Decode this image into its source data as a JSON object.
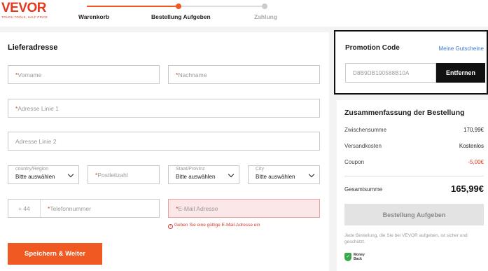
{
  "brand": {
    "name": "VEVOR",
    "tagline": "TOUGH TOOLS, HALF PRICE",
    "accent": "#e4381f"
  },
  "steps": [
    {
      "label": "Warenkorb",
      "state": "done"
    },
    {
      "label": "Bestellung Aufgeben",
      "state": "current"
    },
    {
      "label": "Zahlung",
      "state": "pending"
    }
  ],
  "address": {
    "title": "Lieferadresse",
    "first_name_ph": "Vorname",
    "last_name_ph": "Nachname",
    "address1_ph": "Adresse Linie 1",
    "address2_ph": "Adresse Linie 2",
    "country_label": "country/Region",
    "country_value": "Bitte auswählen",
    "zip_ph": "Postleitzahl",
    "state_label": "Staat/Provinz",
    "state_value": "Bitte auswählen",
    "city_label": "City",
    "city_value": "Bitte auswählen",
    "phone_prefix": "+ 44",
    "phone_ph": "Telefonnummer",
    "email_ph": "E-Mail Adresse",
    "email_error": "Geben Sie eine gültige E-Mail-Adresse ein",
    "save_label": "Speichern & Weiter"
  },
  "promo": {
    "title": "Promotion Code",
    "link": "Meine Gutscheine",
    "code": "D8B9DB190588B10A",
    "remove_label": "Entfernen"
  },
  "summary": {
    "title": "Zusammenfassung der Bestellung",
    "subtotal_label": "Zwischensumme",
    "subtotal_value": "170,99€",
    "shipping_label": "Versandkosten",
    "shipping_value": "Kostenlos",
    "coupon_label": "Coupon",
    "coupon_value": "-5,00€",
    "total_label": "Gesamtsumme",
    "total_value": "165,99€",
    "order_label": "Bestellung Aufgeben",
    "safe_text": "Jede Bestellung, die Sie bei VEVOR aufgeben, ist sicher und geschützt.",
    "badge_line1": "Money",
    "badge_line2": "Back"
  },
  "colors": {
    "coupon": "#e4381f",
    "button_orange": "#f05a22",
    "link": "#3a78c8"
  }
}
